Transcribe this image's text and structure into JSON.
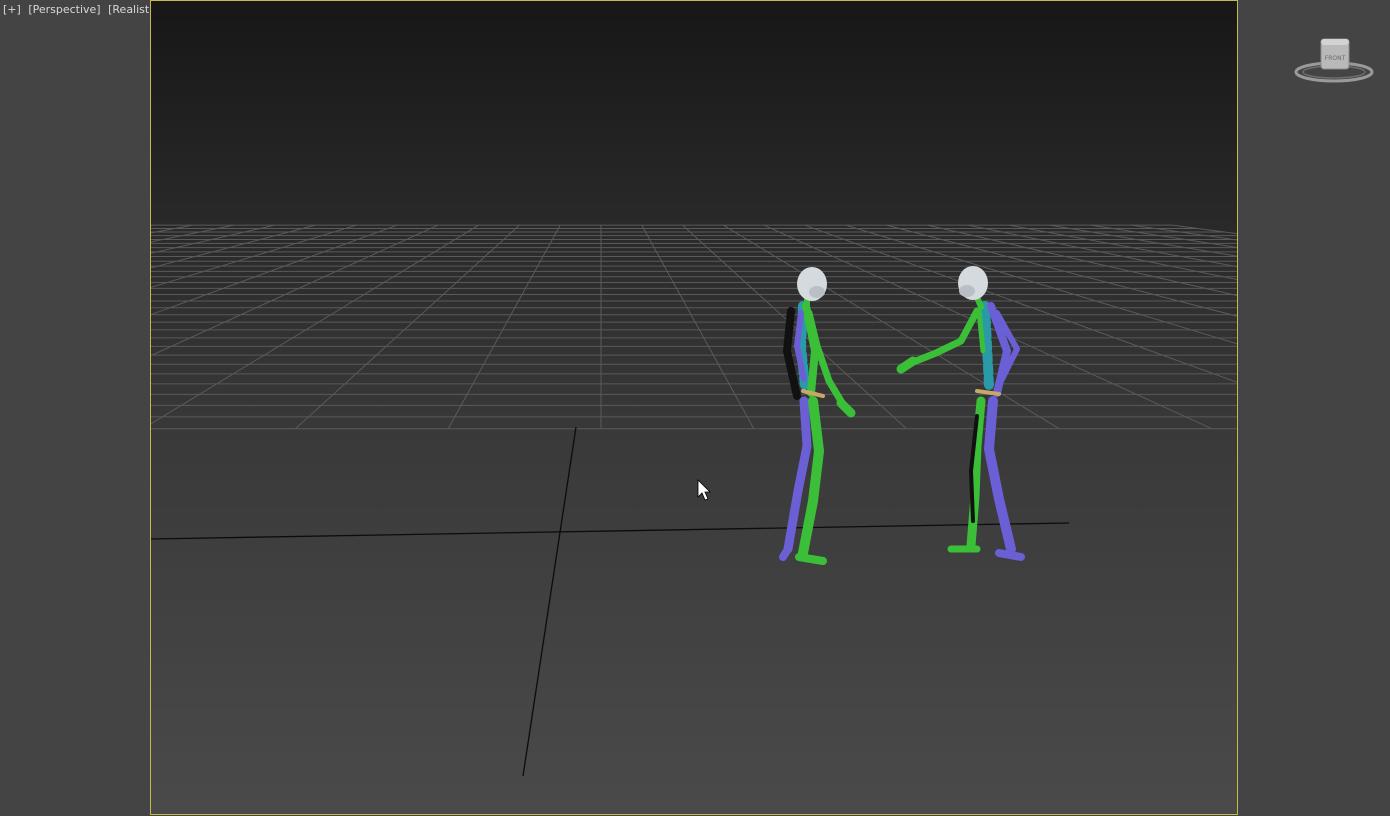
{
  "viewport": {
    "menu_label": "[+]",
    "view_label": "[Perspective]",
    "shading_label": "[Realistic]"
  },
  "viewcube": {
    "face_label": "FRONT"
  },
  "colors": {
    "viewport_border": "#c9b84a",
    "bone_left": "#3fbf3a",
    "bone_right": "#7a6ae0",
    "spine": "#2f9fae",
    "head": "#d8dde2"
  }
}
